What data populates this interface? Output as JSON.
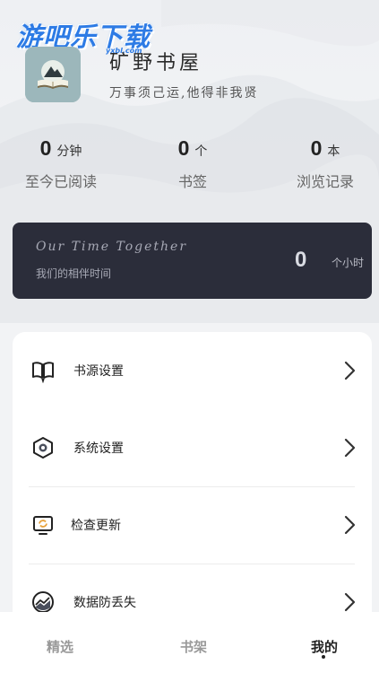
{
  "watermark": {
    "text": "游吧乐下载",
    "sub": "yxbl.com"
  },
  "profile": {
    "app_name": "矿野书屋",
    "motto": "万事须己运,他得非我贤"
  },
  "stats": [
    {
      "value": "0",
      "unit": "分钟",
      "label": "至今已阅读"
    },
    {
      "value": "0",
      "unit": "个",
      "label": "书签"
    },
    {
      "value": "0",
      "unit": "本",
      "label": "浏览记录"
    }
  ],
  "together": {
    "title": "Our Time Together",
    "subtitle": "我们的相伴时间",
    "hours": "0",
    "hours_unit": "个小时"
  },
  "menu": [
    {
      "label": "书源设置",
      "icon": "open-book-icon"
    },
    {
      "label": "系统设置",
      "icon": "settings-hexagon-icon"
    },
    {
      "label": "检查更新",
      "icon": "update-monitor-icon"
    },
    {
      "label": "数据防丢失",
      "icon": "data-chart-icon"
    }
  ],
  "tabs": [
    {
      "label": "精选",
      "active": false
    },
    {
      "label": "书架",
      "active": false
    },
    {
      "label": "我的",
      "active": true
    }
  ],
  "colors": {
    "dark_card": "#2b2d3a",
    "accent_watermark": "#2d7be5",
    "avatar_bg": "#9cb7bb"
  }
}
